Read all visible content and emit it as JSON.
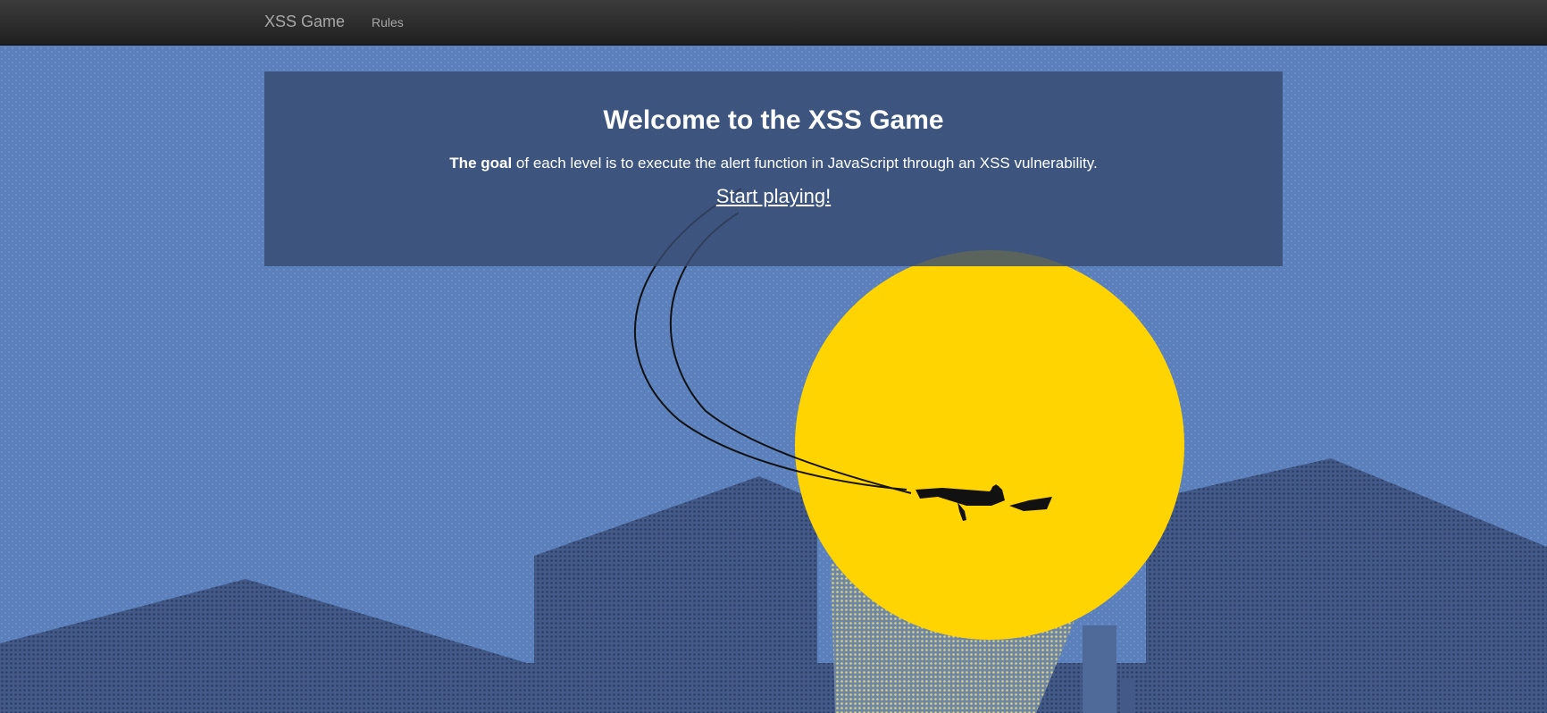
{
  "navbar": {
    "brand": "XSS Game",
    "rules_link": "Rules"
  },
  "welcome": {
    "title": "Welcome to the XSS Game",
    "goal_bold": "The goal",
    "goal_rest": " of each level is to execute the alert function in JavaScript through an XSS vulnerability.",
    "start_link": "Start playing!"
  },
  "colors": {
    "navbar": "#2a2a2a",
    "sky": "#5b80bc",
    "buildings": "#435a89",
    "sun": "#ffd400",
    "panel": "#364a70",
    "text": "#ffffff"
  }
}
